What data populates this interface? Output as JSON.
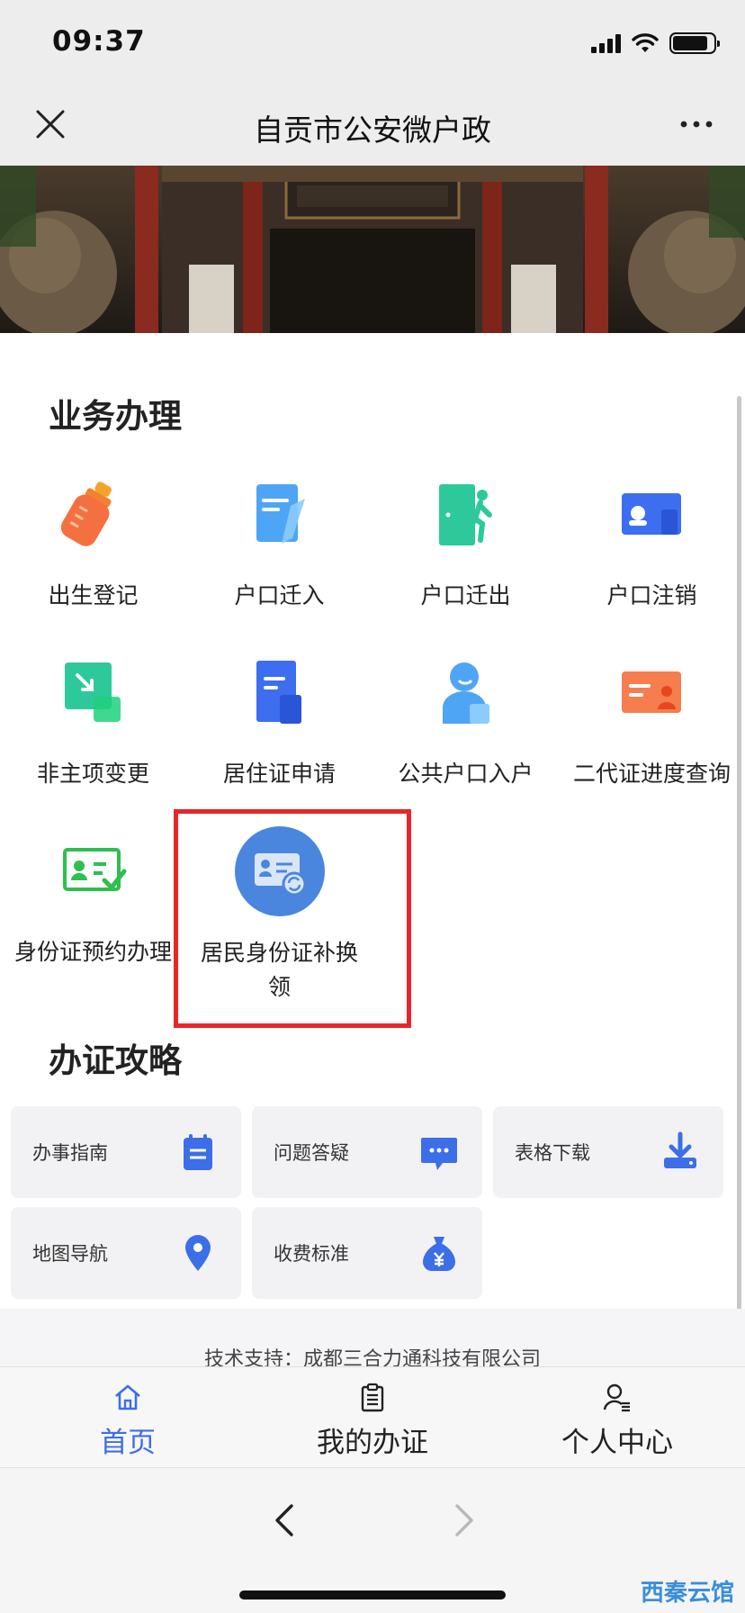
{
  "status_bar": {
    "time": "09:37"
  },
  "nav": {
    "title": "自贡市公安微户政"
  },
  "sections": {
    "business": "业务办理",
    "guides": "办证攻略"
  },
  "services": [
    {
      "label": "出生登记",
      "icon": "baby-bottle-icon"
    },
    {
      "label": "户口迁入",
      "icon": "document-in-icon"
    },
    {
      "label": "户口迁出",
      "icon": "door-exit-icon"
    },
    {
      "label": "户口注销",
      "icon": "id-card-cancel-icon"
    },
    {
      "label": "非主项变更",
      "icon": "arrow-change-icon"
    },
    {
      "label": "居住证申请",
      "icon": "residence-permit-icon"
    },
    {
      "label": "公共户口入户",
      "icon": "person-icon"
    },
    {
      "label": "二代证进度查询",
      "icon": "id-card-query-icon"
    },
    {
      "label": "身份证预约办理",
      "icon": "id-card-check-icon"
    },
    {
      "label": "居民身份证补换\n领",
      "label_line1": "居民身份证补换",
      "label_line2": "领",
      "icon": "id-card-renew-icon"
    }
  ],
  "guides": [
    {
      "label": "办事指南",
      "icon": "calendar-list-icon"
    },
    {
      "label": "问题答疑",
      "icon": "chat-bubble-icon"
    },
    {
      "label": "表格下载",
      "icon": "download-icon"
    },
    {
      "label": "地图导航",
      "icon": "map-pin-icon"
    },
    {
      "label": "收费标准",
      "icon": "money-bag-icon"
    }
  ],
  "footer": {
    "text": "技术支持：成都三合力通科技有限公司"
  },
  "tabs": [
    {
      "label": "首页",
      "icon": "home-icon",
      "active": true
    },
    {
      "label": "我的办证",
      "icon": "clipboard-icon",
      "active": false
    },
    {
      "label": "个人中心",
      "icon": "user-list-icon",
      "active": false
    }
  ],
  "watermark": "西秦云馆",
  "colors": {
    "accent": "#3c6ee8",
    "highlight": "#e8262a"
  }
}
